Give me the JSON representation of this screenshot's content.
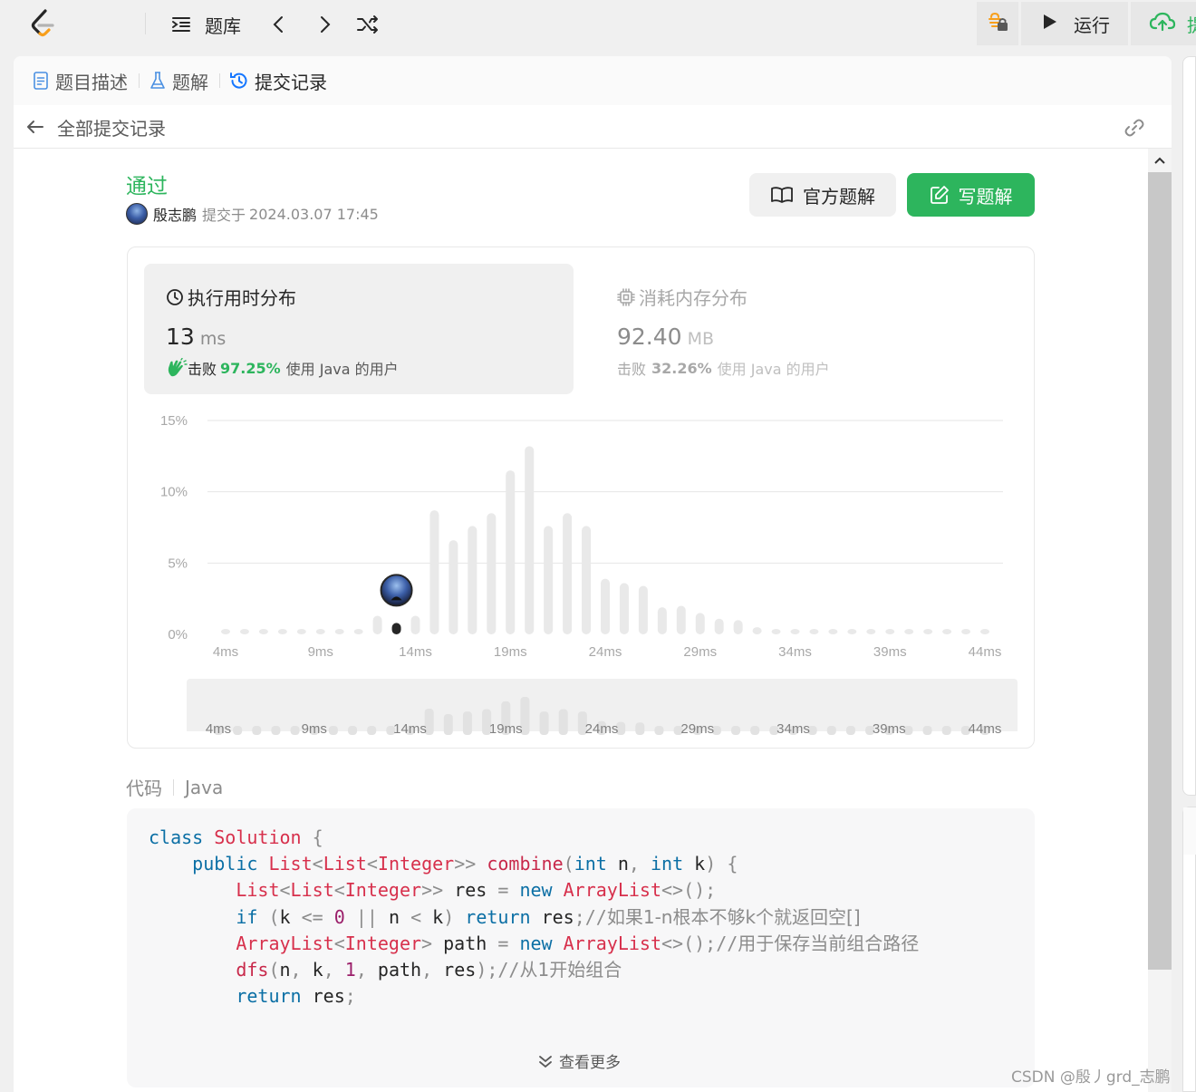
{
  "topbar": {
    "problem_bank_label": "题库",
    "run_label": "运行",
    "submit_label_partial": "提"
  },
  "tabs": [
    {
      "label": "题目描述",
      "icon": "document-icon"
    },
    {
      "label": "题解",
      "icon": "flask-icon"
    },
    {
      "label": "提交记录",
      "icon": "history-icon",
      "active": true
    }
  ],
  "submissions": {
    "back_title": "全部提交记录"
  },
  "result": {
    "status": "通过",
    "author": "殷志鹏",
    "submitted_prefix": "提交于",
    "submitted_time": "2024.03.07 17:45"
  },
  "actions": {
    "official_solution": "官方题解",
    "write_solution": "写题解"
  },
  "runtime": {
    "title": "执行用时分布",
    "value": "13",
    "unit": "ms",
    "beats_prefix": "击败",
    "beats_pct": "97.25%",
    "beats_suffix": "使用 Java 的用户"
  },
  "memory": {
    "title": "消耗内存分布",
    "value": "92.40",
    "unit": "MB",
    "beats_prefix": "击败",
    "beats_pct": "32.26%",
    "beats_suffix": "使用 Java 的用户"
  },
  "colors": {
    "accent_green": "#2db55d",
    "bar_gray": "#e9e9e9",
    "bar_active": "#262626",
    "link_blue": "#0b6fa5"
  },
  "chart_data": {
    "type": "bar",
    "title": "",
    "xlabel": "",
    "ylabel": "",
    "ylim": [
      0,
      15
    ],
    "y_ticks": [
      "15%",
      "10%",
      "5%",
      "0%"
    ],
    "y_tick_values": [
      15,
      10,
      5,
      0
    ],
    "x_tick_labels": [
      "4ms",
      "9ms",
      "14ms",
      "19ms",
      "24ms",
      "29ms",
      "34ms",
      "39ms",
      "44ms"
    ],
    "x_tick_values": [
      4,
      9,
      14,
      19,
      24,
      29,
      34,
      39,
      44
    ],
    "x": [
      4,
      5,
      6,
      7,
      8,
      9,
      10,
      11,
      12,
      13,
      14,
      15,
      16,
      17,
      18,
      19,
      20,
      21,
      22,
      23,
      24,
      25,
      26,
      27,
      28,
      29,
      30,
      31,
      32,
      33,
      34,
      35,
      36,
      37,
      38,
      39,
      40,
      41,
      42,
      43,
      44
    ],
    "values": [
      0.2,
      0.2,
      0.2,
      0.2,
      0.2,
      0.2,
      0.2,
      0.2,
      1.3,
      0.8,
      1.3,
      8.7,
      6.6,
      7.6,
      8.5,
      11.5,
      13.2,
      7.6,
      8.5,
      7.6,
      3.9,
      3.6,
      3.4,
      1.9,
      2.0,
      1.5,
      1.1,
      1.0,
      0.5,
      0.2,
      0.2,
      0.2,
      0.2,
      0.2,
      0.2,
      0.2,
      0.2,
      0.2,
      0.2,
      0.2,
      0.2
    ],
    "highlight_x": 13,
    "grid": true,
    "minimap": true
  },
  "code": {
    "label": "代码",
    "language": "Java",
    "lines": [
      [
        [
          "kw",
          "class"
        ],
        [
          "",
          "&nbsp;"
        ],
        [
          "ty",
          "Solution"
        ],
        [
          "",
          "&nbsp;"
        ],
        [
          "pn",
          "{"
        ]
      ],
      [
        [
          "",
          "&nbsp;&nbsp;&nbsp;&nbsp;"
        ],
        [
          "kw",
          "public"
        ],
        [
          "",
          "&nbsp;"
        ],
        [
          "ty",
          "List"
        ],
        [
          "pn",
          "&lt;"
        ],
        [
          "ty",
          "List"
        ],
        [
          "pn",
          "&lt;"
        ],
        [
          "ty",
          "Integer"
        ],
        [
          "pn",
          "&gt;&gt;"
        ],
        [
          "",
          "&nbsp;"
        ],
        [
          "fn",
          "combine"
        ],
        [
          "pn",
          "("
        ],
        [
          "kw",
          "int"
        ],
        [
          "",
          "&nbsp;n"
        ],
        [
          "pn",
          ","
        ],
        [
          "",
          "&nbsp;"
        ],
        [
          "kw",
          "int"
        ],
        [
          "",
          "&nbsp;k"
        ],
        [
          "pn",
          ")"
        ],
        [
          "",
          "&nbsp;"
        ],
        [
          "pn",
          "{"
        ]
      ],
      [
        [
          "",
          "&nbsp;&nbsp;&nbsp;&nbsp;&nbsp;&nbsp;&nbsp;&nbsp;"
        ],
        [
          "ty",
          "List"
        ],
        [
          "pn",
          "&lt;"
        ],
        [
          "ty",
          "List"
        ],
        [
          "pn",
          "&lt;"
        ],
        [
          "ty",
          "Integer"
        ],
        [
          "pn",
          "&gt;&gt;"
        ],
        [
          "",
          "&nbsp;res&nbsp;"
        ],
        [
          "pn",
          "="
        ],
        [
          "",
          "&nbsp;"
        ],
        [
          "kw",
          "new"
        ],
        [
          "",
          "&nbsp;"
        ],
        [
          "ty",
          "ArrayList"
        ],
        [
          "pn",
          "&lt;&gt;();"
        ]
      ],
      [
        [
          "",
          "&nbsp;&nbsp;&nbsp;&nbsp;&nbsp;&nbsp;&nbsp;&nbsp;"
        ],
        [
          "kw",
          "if"
        ],
        [
          "",
          "&nbsp;"
        ],
        [
          "pn",
          "("
        ],
        [
          "",
          "k&nbsp;"
        ],
        [
          "pn",
          "&lt;="
        ],
        [
          "",
          "&nbsp;"
        ],
        [
          "num",
          "0"
        ],
        [
          "",
          "&nbsp;"
        ],
        [
          "pn",
          "||"
        ],
        [
          "",
          "&nbsp;n&nbsp;"
        ],
        [
          "pn",
          "&lt;"
        ],
        [
          "",
          "&nbsp;k"
        ],
        [
          "pn",
          ")"
        ],
        [
          "",
          "&nbsp;"
        ],
        [
          "kw",
          "return"
        ],
        [
          "",
          "&nbsp;res"
        ],
        [
          "pn",
          ";//"
        ],
        [
          "cm",
          "如果1-n根本不够k个就返回空[]"
        ]
      ],
      [
        [
          "",
          "&nbsp;&nbsp;&nbsp;&nbsp;&nbsp;&nbsp;&nbsp;&nbsp;"
        ],
        [
          "ty",
          "ArrayList"
        ],
        [
          "pn",
          "&lt;"
        ],
        [
          "ty",
          "Integer"
        ],
        [
          "pn",
          "&gt;"
        ],
        [
          "",
          "&nbsp;path&nbsp;"
        ],
        [
          "pn",
          "="
        ],
        [
          "",
          "&nbsp;"
        ],
        [
          "kw",
          "new"
        ],
        [
          "",
          "&nbsp;"
        ],
        [
          "ty",
          "ArrayList"
        ],
        [
          "pn",
          "&lt;&gt;();//"
        ],
        [
          "cm",
          "用于保存当前组合路径"
        ]
      ],
      [
        [
          "",
          "&nbsp;&nbsp;&nbsp;&nbsp;&nbsp;&nbsp;&nbsp;&nbsp;"
        ],
        [
          "fn",
          "dfs"
        ],
        [
          "pn",
          "("
        ],
        [
          "",
          "n"
        ],
        [
          "pn",
          ","
        ],
        [
          "",
          "&nbsp;k"
        ],
        [
          "pn",
          ","
        ],
        [
          "",
          "&nbsp;"
        ],
        [
          "num",
          "1"
        ],
        [
          "pn",
          ","
        ],
        [
          "",
          "&nbsp;path"
        ],
        [
          "pn",
          ","
        ],
        [
          "",
          "&nbsp;res"
        ],
        [
          "pn",
          ");//"
        ],
        [
          "cm",
          "从1开始组合"
        ]
      ],
      [
        [
          "",
          "&nbsp;&nbsp;&nbsp;&nbsp;&nbsp;&nbsp;&nbsp;&nbsp;"
        ],
        [
          "kw",
          "return"
        ],
        [
          "",
          "&nbsp;res"
        ],
        [
          "pn",
          ";"
        ]
      ]
    ],
    "show_more": "查看更多"
  },
  "watermark": "CSDN @殷丿grd_志鹏"
}
